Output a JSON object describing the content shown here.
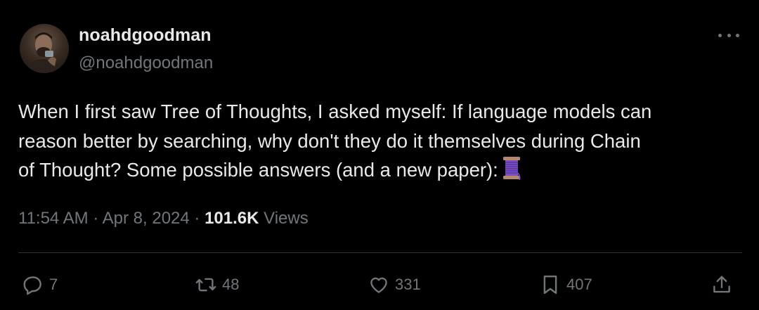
{
  "author": {
    "display_name": "noahdgoodman",
    "handle": "@noahdgoodman",
    "avatar_icon": "user-avatar"
  },
  "tweet": {
    "text": "When I first saw Tree of Thoughts, I asked myself: If language models can\nreason better by searching, why don't they do it themselves during Chain\nof Thought? Some possible answers (and a new paper):",
    "thread_icon": "spool-of-thread-emoji"
  },
  "meta": {
    "time": "11:54 AM",
    "date": "Apr 8, 2024",
    "separator": "·",
    "views_count": "101.6K",
    "views_label": "Views"
  },
  "actions": {
    "replies": "7",
    "reposts": "48",
    "likes": "331",
    "bookmarks": "407"
  },
  "colors": {
    "background": "#000000",
    "text_primary": "#e7e9ea",
    "text_secondary": "#71767b",
    "divider": "#2f3336"
  }
}
